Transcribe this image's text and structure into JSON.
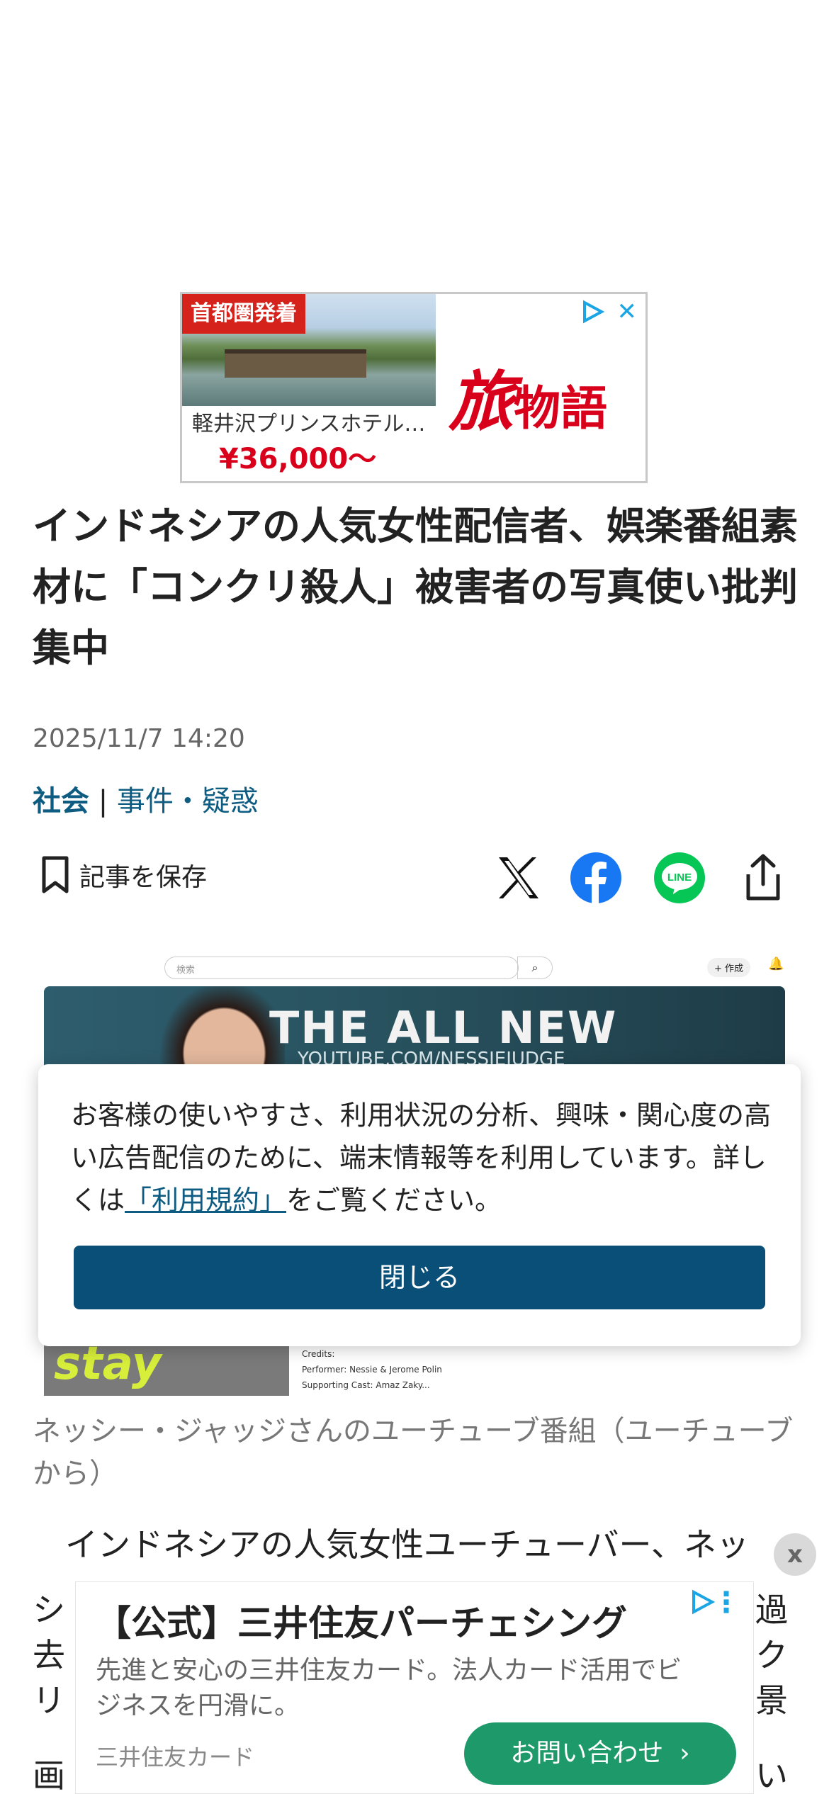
{
  "top_ad": {
    "tag": "首都圏発着",
    "brand_part1": "旅",
    "brand_part2": "物語",
    "hotel": "軽井沢プリンスホテル…",
    "price": "¥36,000〜",
    "close_icon": "close-icon",
    "adchoices_icon": "adchoices-icon"
  },
  "article": {
    "headline": "インドネシアの人気女性配信者、娯楽番組素材に「コンクリ殺人」被害者の写真使い批判集中",
    "date": "2025/11/7 14:20",
    "category": "社会",
    "separator": "|",
    "subcategory": "事件・疑惑",
    "save_label": "記事を保存",
    "image_caption": "ネッシー・ジャッジさんのユーチューブ番組（ユーチューブから）",
    "body_first_line": "インドネシアの人気女性ユーチューバー、ネッ",
    "body_fragments": [
      "シ",
      "過",
      "去",
      "ク",
      "リ",
      "景",
      "画",
      "い"
    ]
  },
  "share": {
    "x_icon": "x-icon",
    "facebook_icon": "facebook-icon",
    "line_label": "LINE",
    "share_icon": "share-icon"
  },
  "image_content": {
    "search_placeholder": "検索",
    "create_label": "+ 作成",
    "banner_title": "THE ALL NEW",
    "banner_subtitle": "YOUTUBE.COM/NESSIEJUDGE",
    "stay_text": "stay",
    "credits_heading": "Credits:",
    "credits_line1": "Performer: Nessie & Jerome Polin",
    "credits_line2": "Supporting Cast: Amaz Zaky..."
  },
  "consent": {
    "text_before": "お客様の使いやすさ、利用状況の分析、興味・関心度の高い広告配信のために、端末情報等を利用しています。詳しくは",
    "link": "「利用規約」",
    "text_after": "をご覧ください。",
    "close_button": "閉じる"
  },
  "bottom_ad": {
    "dismiss": "x",
    "title": "【公式】三井住友パーチェシング",
    "description": "先進と安心の三井住友カード。法人カード活用でビジネスを円滑に。",
    "sponsor": "三井住友カード",
    "cta": "お問い合わせ",
    "cta_arrow": "›"
  },
  "colors": {
    "link_blue": "#0e5c82",
    "button_navy": "#0a4f77",
    "ad_red": "#d9001b",
    "cta_green": "#1e9a6a",
    "facebook_blue": "#1877f2",
    "line_green": "#06c755"
  }
}
